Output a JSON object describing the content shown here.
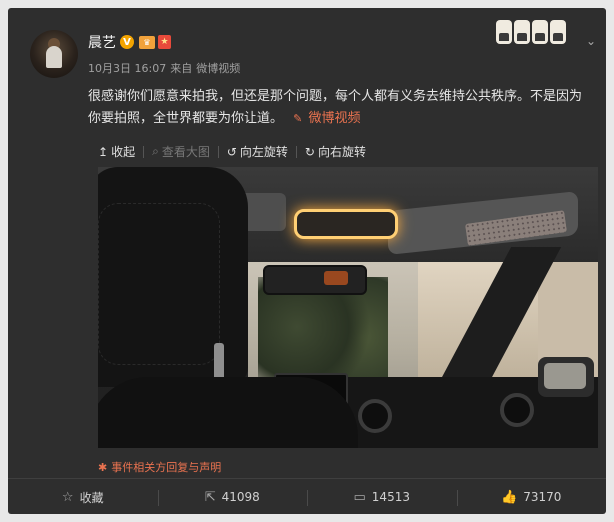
{
  "user": {
    "name": "晨艺",
    "verified_badge": "V",
    "crown_badge": "♛",
    "medal_badge": "★"
  },
  "meta": {
    "time": "10月3日 16:07",
    "source_prefix": "来自",
    "source": "微博视频"
  },
  "post": {
    "text": "很感谢你们愿意来拍我，但还是那个问题，每个人都有义务去维持公共秩序。不是因为你要拍照，全世界都要为你让道。",
    "link_label": "微博视频",
    "link_icon": "link-icon"
  },
  "toolbar": {
    "collapse": "收起",
    "view_large": "查看大图",
    "rotate_left": "向左旋转",
    "rotate_right": "向右旋转",
    "collapse_icon": "↥",
    "search_icon": "⌕",
    "rotate_left_icon": "↺",
    "rotate_right_icon": "↻"
  },
  "notice": {
    "icon": "✱",
    "text": "事件相关方回复与声明"
  },
  "actions": {
    "favorite": {
      "icon": "☆",
      "label": "收藏"
    },
    "repost": {
      "icon": "⇱",
      "label": "41098"
    },
    "comment": {
      "icon": "▭",
      "label": "14513"
    },
    "like": {
      "icon": "👍",
      "label": "73170"
    }
  },
  "colors": {
    "card_bg": "#2e2e2e",
    "accent": "#eb7350",
    "text": "#e6e6e6",
    "muted": "#a0a0a0"
  }
}
